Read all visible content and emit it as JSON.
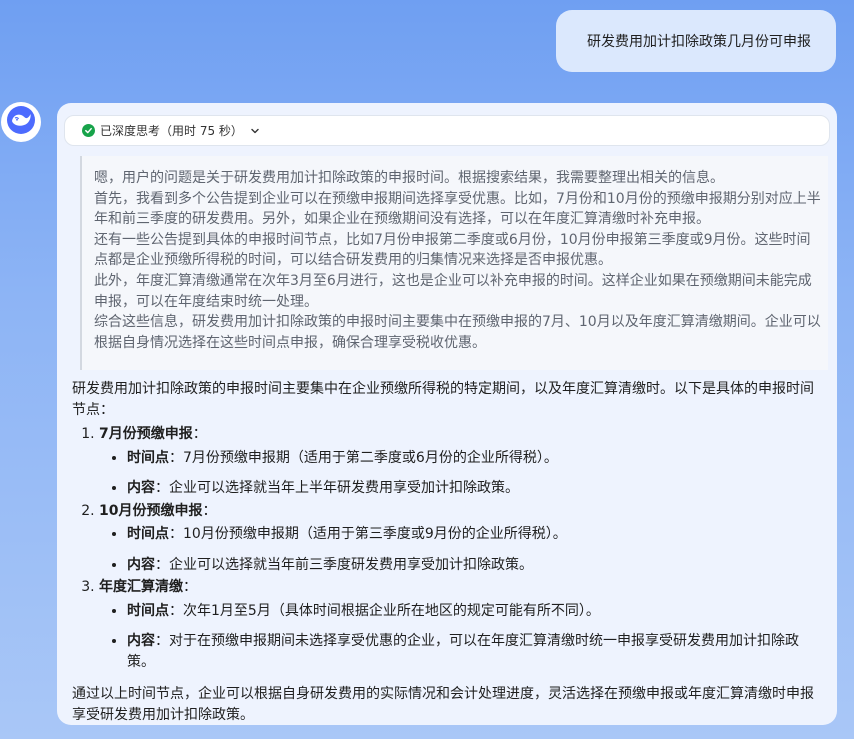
{
  "user_message": "研发费用加计扣除政策几月份可申报",
  "thinking": {
    "status": "已深度思考（用时 75 秒）",
    "paragraphs": [
      "嗯，用户的问题是关于研发费用加计扣除政策的申报时间。根据搜索结果，我需要整理出相关的信息。",
      "首先，我看到多个公告提到企业可以在预缴申报期间选择享受优惠。比如，7月份和10月份的预缴申报期分别对应上半年和前三季度的研发费用。另外，如果企业在预缴期间没有选择，可以在年度汇算清缴时补充申报。",
      "还有一些公告提到具体的申报时间节点，比如7月份申报第二季度或6月份，10月份申报第三季度或9月份。这些时间点都是企业预缴所得税的时间，可以结合研发费用的归集情况来选择是否申报优惠。",
      "此外，年度汇算清缴通常在次年3月至6月进行，这也是企业可以补充申报的时间。这样企业如果在预缴期间未能完成申报，可以在年度结束时统一处理。",
      "综合这些信息，研发费用加计扣除政策的申报时间主要集中在预缴申报的7月、10月以及年度汇算清缴期间。企业可以根据自身情况选择在这些时间点申报，确保合理享受税收优惠。"
    ]
  },
  "answer": {
    "intro": "研发费用加计扣除政策的申报时间主要集中在企业预缴所得税的特定期间，以及年度汇算清缴时。以下是具体的申报时间节点：",
    "items": [
      {
        "title": "7月份预缴申报",
        "colon": "：",
        "points": [
          {
            "label": "时间点",
            "sep": "：",
            "text": "7月份预缴申报期（适用于第二季度或6月份的企业所得税）。"
          },
          {
            "label": "内容",
            "sep": "：",
            "text": "企业可以选择就当年上半年研发费用享受加计扣除政策。"
          }
        ]
      },
      {
        "title": "10月份预缴申报",
        "colon": "：",
        "points": [
          {
            "label": "时间点",
            "sep": "：",
            "text": "10月份预缴申报期（适用于第三季度或9月份的企业所得税）。"
          },
          {
            "label": "内容",
            "sep": "：",
            "text": "企业可以选择就当年前三季度研发费用享受加计扣除政策。"
          }
        ]
      },
      {
        "title": "年度汇算清缴",
        "colon": "：",
        "points": [
          {
            "label": "时间点",
            "sep": "：",
            "text": "次年1月至5月（具体时间根据企业所在地区的规定可能有所不同）。"
          },
          {
            "label": "内容",
            "sep": "：",
            "text": "对于在预缴申报期间未选择享受优惠的企业，可以在年度汇算清缴时统一申报享受研发费用加计扣除政策。"
          }
        ]
      }
    ],
    "closing": "通过以上时间节点，企业可以根据自身研发费用的实际情况和会计处理进度，灵活选择在预缴申报或年度汇算清缴时申报享受研发费用加计扣除政策。"
  },
  "icons": {
    "avatar": "deepseek-whale-icon",
    "think_status": "check-circle-icon",
    "think_toggle": "chevron-down-icon"
  },
  "colors": {
    "brand": "#4d6bfe",
    "success": "#17a34a"
  }
}
